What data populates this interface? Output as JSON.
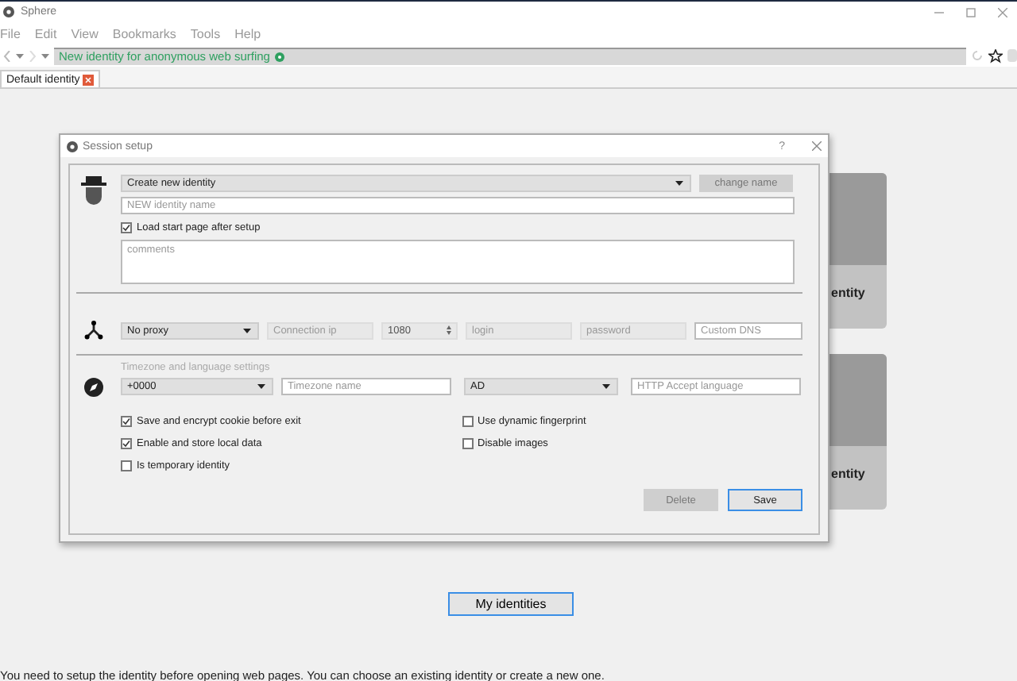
{
  "window": {
    "title": "Sphere"
  },
  "menu": [
    "File",
    "Edit",
    "View",
    "Bookmarks",
    "Tools",
    "Help"
  ],
  "address_bar": {
    "text": "New identity for anonymous web surfing"
  },
  "tabs": [
    {
      "label": "Default identity",
      "selected": true
    }
  ],
  "cards": [
    {
      "label": "entity"
    },
    {
      "label": "entity"
    }
  ],
  "my_identities_button": "My identities",
  "hint": "You need to setup the identity before opening web pages. You can choose an existing identity or create a new one.",
  "dialog": {
    "title": "Session setup",
    "help": "?",
    "identity": {
      "mode": "Create new identity",
      "change_name": {
        "label": "change name",
        "disabled": true
      },
      "name_placeholder": "NEW identity name",
      "load_start_page": {
        "label": "Load start page after setup",
        "checked": true
      },
      "comments_placeholder": "comments"
    },
    "proxy": {
      "type": "No proxy",
      "fields": [
        {
          "kind": "input",
          "placeholder": "Connection ip",
          "disabled": true
        },
        {
          "kind": "spin",
          "value": "1080",
          "disabled": true
        },
        {
          "kind": "input",
          "placeholder": "login",
          "disabled": true
        },
        {
          "kind": "input",
          "placeholder": "password",
          "disabled": true
        },
        {
          "kind": "input",
          "placeholder": "Custom DNS",
          "disabled": false
        }
      ]
    },
    "locale": {
      "heading": "Timezone and language settings",
      "timezone": "+0000",
      "timezone_placeholder": "Timezone name",
      "language": "AD",
      "accept_placeholder": "HTTP Accept language"
    },
    "options_left": [
      {
        "label": "Save and encrypt cookie before exit",
        "checked": true
      },
      {
        "label": "Enable and store local data",
        "checked": true
      },
      {
        "label": "Is temporary identity",
        "checked": false
      }
    ],
    "options_right": [
      {
        "label": "Use dynamic fingerprint",
        "checked": false
      },
      {
        "label": "Disable images",
        "checked": false
      }
    ],
    "buttons": [
      {
        "label": "Delete",
        "disabled": true,
        "focused": false
      },
      {
        "label": "Save",
        "disabled": false,
        "focused": true
      }
    ]
  }
}
